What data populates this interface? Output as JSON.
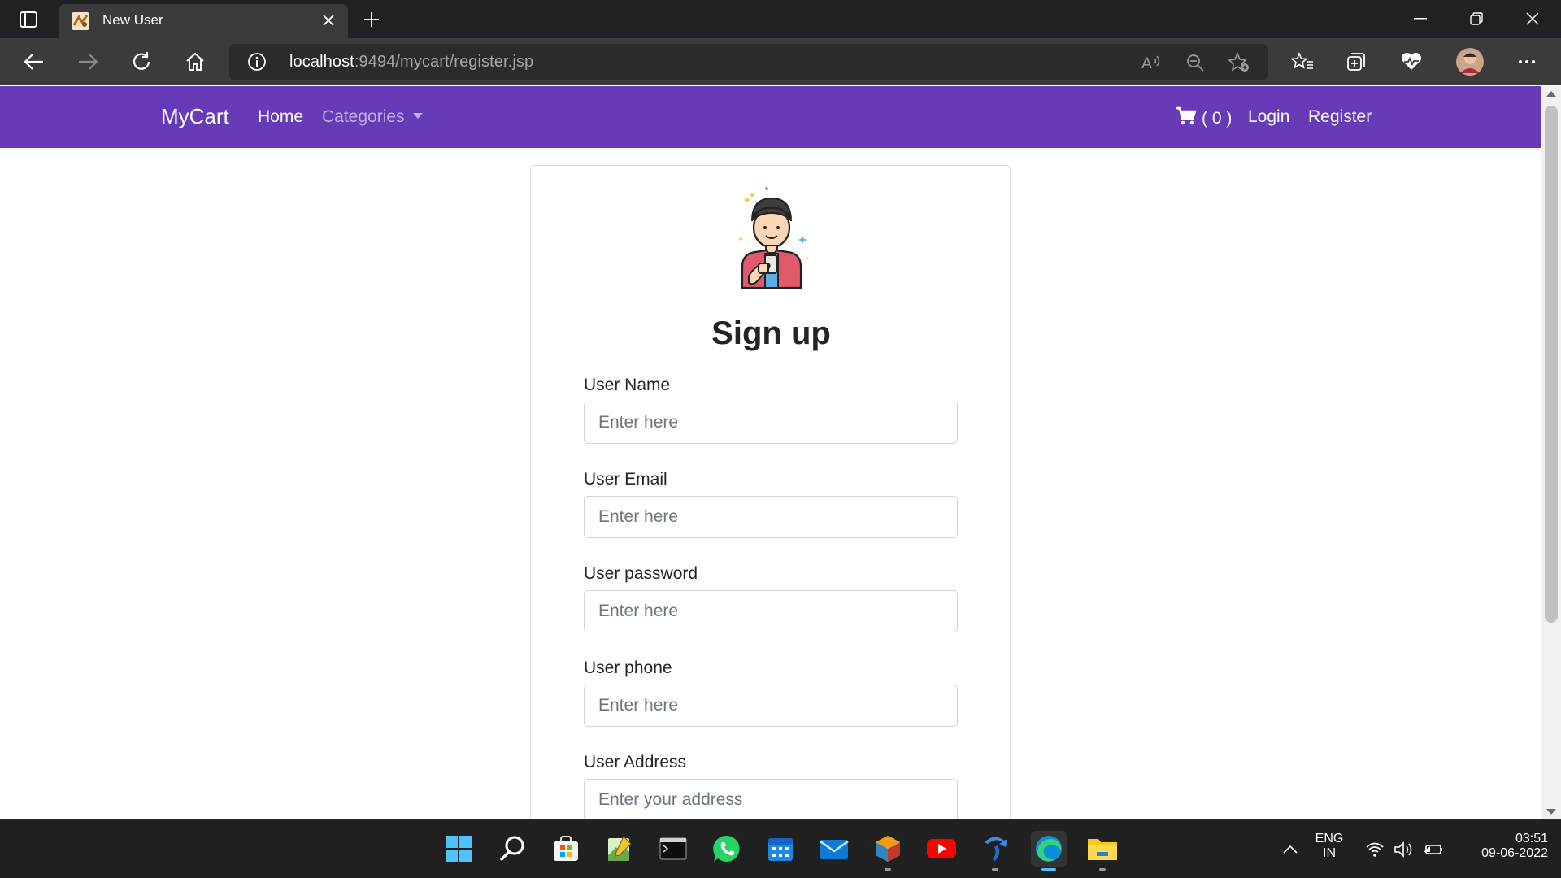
{
  "browser": {
    "tab_title": "New User",
    "url_host": "localhost",
    "url_rest": ":9494/mycart/register.jsp"
  },
  "navbar": {
    "brand": "MyCart",
    "home": "Home",
    "categories": "Categories",
    "cart_count": "( 0 )",
    "login": "Login",
    "register": "Register",
    "color": "#673ab7"
  },
  "form": {
    "title": "Sign up",
    "fields": [
      {
        "label": "User Name",
        "placeholder": "Enter here"
      },
      {
        "label": "User Email",
        "placeholder": "Enter here"
      },
      {
        "label": "User password",
        "placeholder": "Enter here"
      },
      {
        "label": "User phone",
        "placeholder": "Enter here"
      },
      {
        "label": "User Address",
        "placeholder": "Enter your address"
      }
    ]
  },
  "taskbar": {
    "apps": [
      "start-icon",
      "search-icon",
      "store-icon",
      "notepad-icon",
      "terminal-icon",
      "whatsapp-icon",
      "calendar-icon",
      "mail-icon",
      "app-cube-icon",
      "youtube-icon",
      "tool-icon",
      "edge-icon",
      "file-explorer-icon"
    ],
    "language_line1": "ENG",
    "language_line2": "IN",
    "time": "03:51",
    "date": "09-06-2022"
  }
}
